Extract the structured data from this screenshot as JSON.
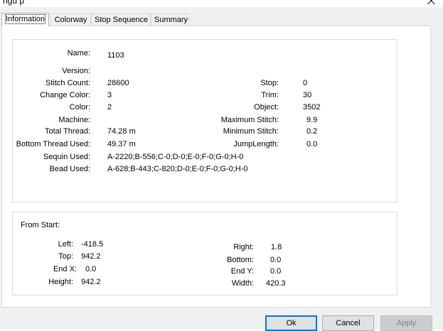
{
  "window": {
    "title_fragment": "ngu p"
  },
  "tabs": [
    {
      "label": "Information",
      "active": true
    },
    {
      "label": "Colorway",
      "active": false
    },
    {
      "label": "Stop Sequence",
      "active": false
    },
    {
      "label": "Summary",
      "active": false
    }
  ],
  "information": {
    "name": {
      "label": "Name:",
      "value": "1103"
    },
    "version": {
      "label": "Version:",
      "value": ""
    },
    "stitch_count": {
      "label": "Stitch Count:",
      "value": "28600"
    },
    "change_color": {
      "label": "Change Color:",
      "value": "3"
    },
    "color": {
      "label": "Color:",
      "value": "2"
    },
    "machine": {
      "label": "Machine:",
      "value": ""
    },
    "total_thread": {
      "label": "Total Thread:",
      "value": "74.28 m"
    },
    "bottom_thread": {
      "label": "Bottom Thread Used:",
      "value": "49.37 m"
    },
    "sequin_used": {
      "label": "Sequin Used:",
      "value": "A-2220;B-556;C-0;D-0;E-0;F-0;G-0;H-0"
    },
    "bead_used": {
      "label": "Bead Used:",
      "value": "A-628;B-443;C-820;D-0;E-0;F-0;G-0;H-0"
    },
    "stop": {
      "label": "Stop:",
      "value": "0"
    },
    "trim": {
      "label": "Trim:",
      "value": "30"
    },
    "object": {
      "label": "Object:",
      "value": "3502"
    },
    "max_stitch": {
      "label": "Maximum Stitch:",
      "value": "9.9"
    },
    "min_stitch": {
      "label": "Minimum Stitch:",
      "value": "0.2"
    },
    "jump_length": {
      "label": "JumpLength:",
      "value": "0.0"
    }
  },
  "from_start": {
    "heading": "From Start:",
    "left": {
      "label": "Left:",
      "value": "-418.5"
    },
    "top": {
      "label": "Top:",
      "value": "942.2"
    },
    "end_x": {
      "label": "End X:",
      "value": "0.0"
    },
    "height": {
      "label": "Height:",
      "value": "942.2"
    },
    "right": {
      "label": "Right:",
      "value": "1.8"
    },
    "bottom": {
      "label": "Bottom:",
      "value": "0.0"
    },
    "end_y": {
      "label": "End Y:",
      "value": "0.0"
    },
    "width": {
      "label": "Width:",
      "value": "420.3"
    }
  },
  "buttons": {
    "ok": "Ok",
    "cancel": "Cancel",
    "apply": "Apply"
  }
}
